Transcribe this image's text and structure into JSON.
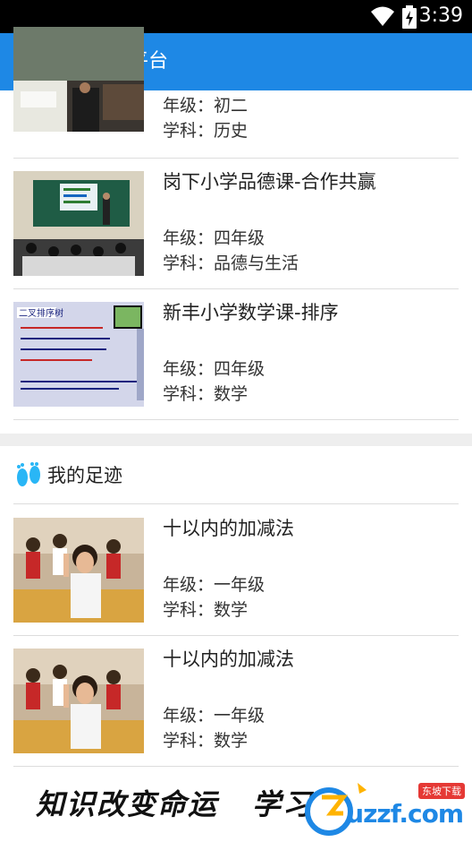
{
  "status_bar": {
    "time": "3:39"
  },
  "app_bar": {
    "title": "紫旭云平台"
  },
  "courses": [
    {
      "name": "",
      "grade": "年级：初二",
      "subject": "学科：历史"
    },
    {
      "name": "岗下小学品德课-合作共赢",
      "grade": "年级：四年级",
      "subject": "学科：品德与生活"
    },
    {
      "name": "新丰小学数学课-排序",
      "grade": "年级：四年级",
      "subject": "学科：数学"
    }
  ],
  "footprints": {
    "header": "我的足迹",
    "icon": "footprints-icon",
    "items": [
      {
        "name": "十以内的加减法",
        "grade": "年级：一年级",
        "subject": "学科：数学"
      },
      {
        "name": "十以内的加减法",
        "grade": "年级：一年级",
        "subject": "学科：数学"
      }
    ]
  },
  "banner": {
    "slogan_left": "知识改变命运",
    "slogan_right": "学习",
    "watermark_text": "uzzf.com",
    "watermark_tag": "东坡下载"
  },
  "colors": {
    "app_bar": "#1e88e5",
    "status_bar": "#000000",
    "divider": "#eeeeee"
  }
}
